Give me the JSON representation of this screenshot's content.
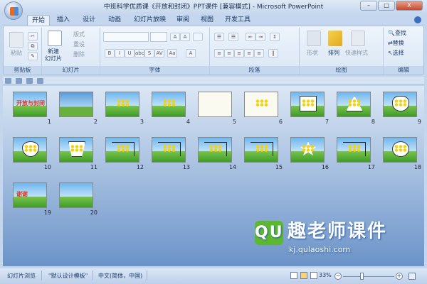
{
  "window": {
    "title": "中班科学优质课《开放和封闭》PPT课件 [兼容模式] - Microsoft PowerPoint",
    "minimize": "–",
    "maximize": "□",
    "close": "X"
  },
  "tabs": [
    "开始",
    "插入",
    "设计",
    "动画",
    "幻灯片放映",
    "审阅",
    "视图",
    "开发工具"
  ],
  "ribbon": {
    "clipboard": {
      "label": "剪贴板",
      "paste": "粘贴"
    },
    "slides": {
      "label": "幻灯片",
      "new_slide": "新建",
      "new_slide2": "幻灯片",
      "layout": "版式",
      "reset": "重设",
      "delete": "删除"
    },
    "font": {
      "label": "字体",
      "bold": "B",
      "italic": "I",
      "underline": "U",
      "strike": "abc",
      "shadow": "S",
      "spacing": "AV",
      "case": "Aa",
      "color": "A",
      "grow": "A",
      "shrink": "A"
    },
    "paragraph": {
      "label": "段落"
    },
    "drawing": {
      "label": "绘图",
      "shapes": "形状",
      "arrange": "排列",
      "quick_styles": "快速样式"
    },
    "editing": {
      "label": "编辑",
      "find": "查找",
      "replace": "替换",
      "select": "选择"
    }
  },
  "slides": [
    {
      "n": "1",
      "title": "开放与封闭"
    },
    {
      "n": "2"
    },
    {
      "n": "3"
    },
    {
      "n": "4"
    },
    {
      "n": "5"
    },
    {
      "n": "6"
    },
    {
      "n": "7"
    },
    {
      "n": "8"
    },
    {
      "n": "9"
    },
    {
      "n": "10"
    },
    {
      "n": "11"
    },
    {
      "n": "12"
    },
    {
      "n": "13"
    },
    {
      "n": "14"
    },
    {
      "n": "15"
    },
    {
      "n": "16"
    },
    {
      "n": "17"
    },
    {
      "n": "18"
    },
    {
      "n": "19",
      "title": "谢谢"
    },
    {
      "n": "20"
    }
  ],
  "watermark": {
    "logo": "QU",
    "name": "趣老师课件",
    "url": "kj.qulaoshi.com"
  },
  "status": {
    "view": "幻灯片浏览",
    "theme": "\"默认设计模板\"",
    "language": "中文(简体，中国)",
    "zoom": "33%",
    "zoom_fraction": 0.33
  }
}
